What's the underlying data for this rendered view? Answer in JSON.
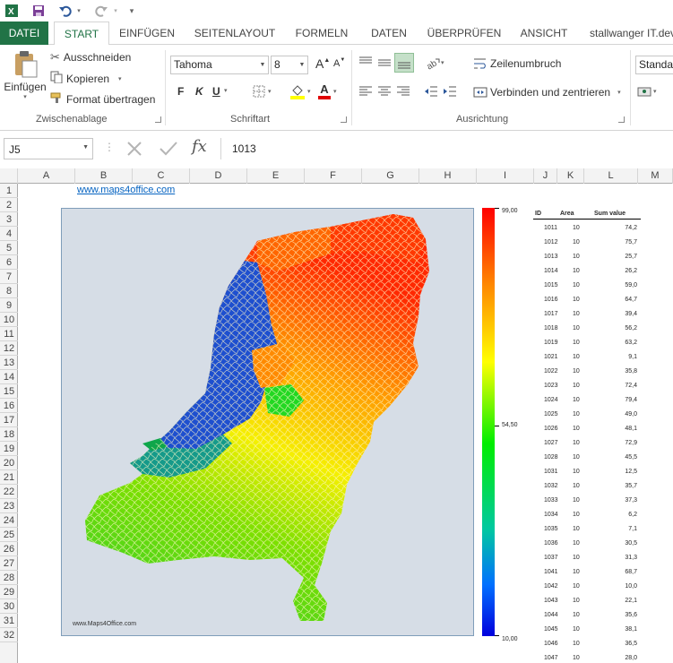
{
  "qat": {
    "customize_glyph": "▾"
  },
  "tabs": [
    {
      "label": "DATEI"
    },
    {
      "label": "START"
    },
    {
      "label": "EINFÜGEN"
    },
    {
      "label": "SEITENLAYOUT"
    },
    {
      "label": "FORMELN"
    },
    {
      "label": "DATEN"
    },
    {
      "label": "ÜBERPRÜFEN"
    },
    {
      "label": "ANSICHT"
    },
    {
      "label": "stallwanger IT.dev"
    }
  ],
  "ribbon": {
    "clipboard": {
      "paste": "Einfügen",
      "cut": "Ausschneiden",
      "copy": "Kopieren",
      "format_painter": "Format übertragen",
      "group": "Zwischenablage"
    },
    "font": {
      "name": "Tahoma",
      "size": "8",
      "bold": "F",
      "italic": "K",
      "underline": "U",
      "grow": "A",
      "shrink": "A",
      "color_letter": "A",
      "group": "Schriftart"
    },
    "alignment": {
      "wrap": "Zeilenumbruch",
      "merge": "Verbinden und zentrieren",
      "group": "Ausrichtung"
    },
    "number": {
      "format": "Standard"
    }
  },
  "formula_bar": {
    "name_box": "J5",
    "fx": "fx",
    "value": "1013"
  },
  "columns": [
    "A",
    "B",
    "C",
    "D",
    "E",
    "F",
    "G",
    "H",
    "I",
    "J",
    "K",
    "L",
    "M"
  ],
  "rows": [
    "1",
    "2",
    "3",
    "4",
    "5",
    "6",
    "7",
    "8",
    "9",
    "10",
    "11",
    "12",
    "13",
    "14",
    "15",
    "16",
    "17",
    "18",
    "19",
    "20",
    "21",
    "22",
    "23",
    "24",
    "25",
    "26",
    "27",
    "28",
    "29",
    "30",
    "31",
    "32"
  ],
  "sheet": {
    "link": "www.maps4office.com",
    "map_watermark": "www.Maps4Office.com",
    "legend": {
      "max": "99,00",
      "mid": "54,50",
      "min": "10,00"
    },
    "table_headers": {
      "id": "ID",
      "area": "Area",
      "sum": "Sum value"
    },
    "table_rows": [
      {
        "id": "1011",
        "area": "10",
        "sum": "74,2"
      },
      {
        "id": "1012",
        "area": "10",
        "sum": "75,7"
      },
      {
        "id": "1013",
        "area": "10",
        "sum": "25,7"
      },
      {
        "id": "1014",
        "area": "10",
        "sum": "26,2"
      },
      {
        "id": "1015",
        "area": "10",
        "sum": "59,0"
      },
      {
        "id": "1016",
        "area": "10",
        "sum": "64,7"
      },
      {
        "id": "1017",
        "area": "10",
        "sum": "39,4"
      },
      {
        "id": "1018",
        "area": "10",
        "sum": "56,2"
      },
      {
        "id": "1019",
        "area": "10",
        "sum": "63,2"
      },
      {
        "id": "1021",
        "area": "10",
        "sum": "9,1"
      },
      {
        "id": "1022",
        "area": "10",
        "sum": "35,8"
      },
      {
        "id": "1023",
        "area": "10",
        "sum": "72,4"
      },
      {
        "id": "1024",
        "area": "10",
        "sum": "79,4"
      },
      {
        "id": "1025",
        "area": "10",
        "sum": "49,0"
      },
      {
        "id": "1026",
        "area": "10",
        "sum": "48,1"
      },
      {
        "id": "1027",
        "area": "10",
        "sum": "72,9"
      },
      {
        "id": "1028",
        "area": "10",
        "sum": "45,5"
      },
      {
        "id": "1031",
        "area": "10",
        "sum": "12,5"
      },
      {
        "id": "1032",
        "area": "10",
        "sum": "35,7"
      },
      {
        "id": "1033",
        "area": "10",
        "sum": "37,3"
      },
      {
        "id": "1034",
        "area": "10",
        "sum": "6,2"
      },
      {
        "id": "1035",
        "area": "10",
        "sum": "7,1"
      },
      {
        "id": "1036",
        "area": "10",
        "sum": "30,5"
      },
      {
        "id": "1037",
        "area": "10",
        "sum": "31,3"
      },
      {
        "id": "1041",
        "area": "10",
        "sum": "68,7"
      },
      {
        "id": "1042",
        "area": "10",
        "sum": "10,0"
      },
      {
        "id": "1043",
        "area": "10",
        "sum": "22,1"
      },
      {
        "id": "1044",
        "area": "10",
        "sum": "35,6"
      },
      {
        "id": "1045",
        "area": "10",
        "sum": "38,1"
      },
      {
        "id": "1046",
        "area": "10",
        "sum": "36,5"
      },
      {
        "id": "1047",
        "area": "10",
        "sum": "28,0"
      }
    ]
  },
  "colors": {
    "excel_green": "#217346",
    "map_bg": "#d6dde6"
  }
}
